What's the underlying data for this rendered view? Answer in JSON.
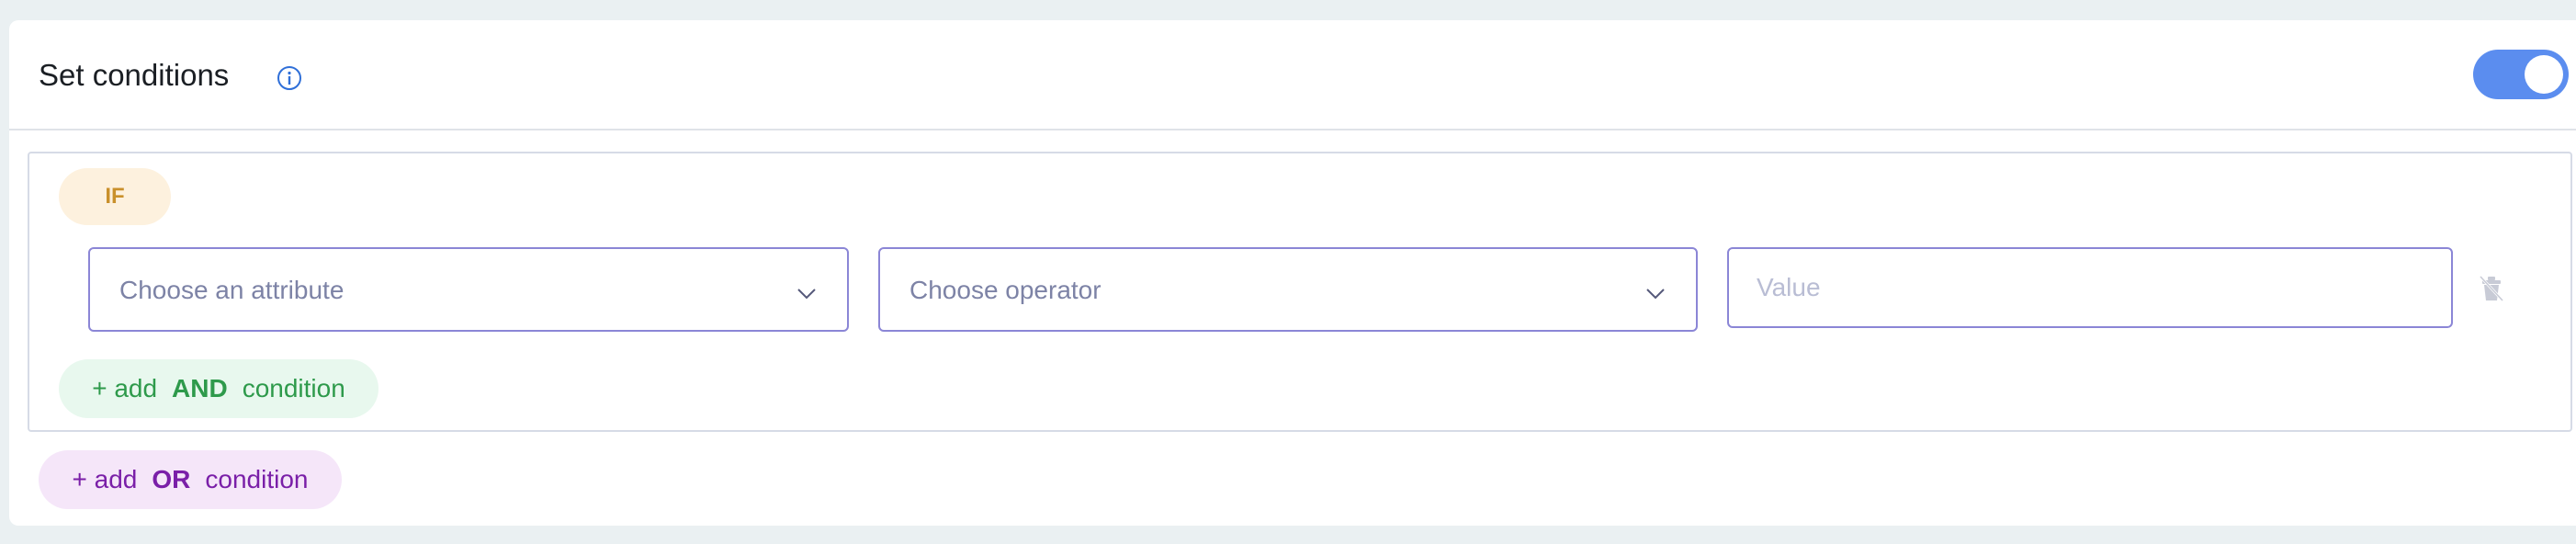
{
  "header": {
    "title": "Set conditions",
    "info_icon": "info-icon",
    "toggle_state": "on",
    "toggle_color": "#5b8def"
  },
  "condition_group": {
    "if_label": "IF",
    "attribute_select": {
      "placeholder": "Choose an attribute"
    },
    "operator_select": {
      "placeholder": "Choose operator"
    },
    "value_input": {
      "placeholder": "Value",
      "value": ""
    },
    "delete_icon": "trash-icon",
    "add_and": {
      "prefix": "+ add",
      "keyword": "AND",
      "suffix": "condition"
    }
  },
  "add_or": {
    "prefix": "+ add",
    "keyword": "OR",
    "suffix": "condition"
  },
  "colors": {
    "if_pill_bg": "#fdf1de",
    "if_pill_text": "#c9902b",
    "and_bg": "#e8f8ee",
    "and_text": "#2e9a4b",
    "or_bg": "#f5e6f9",
    "or_text": "#7a1fa8",
    "select_border": "#8b86d6"
  }
}
